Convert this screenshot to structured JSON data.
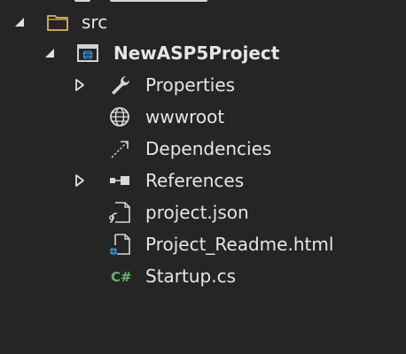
{
  "solution_explorer": {
    "items": [
      {
        "label": "src",
        "icon": "folder-icon",
        "expanded": true
      },
      {
        "label": "NewASP5Project",
        "icon": "web-project-icon",
        "expanded": true
      },
      {
        "label": "Properties",
        "icon": "wrench-icon",
        "expanded": false
      },
      {
        "label": "wwwroot",
        "icon": "globe-icon"
      },
      {
        "label": "Dependencies",
        "icon": "dependencies-arrow-icon"
      },
      {
        "label": "References",
        "icon": "references-icon",
        "expanded": false
      },
      {
        "label": "project.json",
        "icon": "json-file-icon"
      },
      {
        "label": "Project_Readme.html",
        "icon": "html-file-icon"
      },
      {
        "label": "Startup.cs",
        "icon": "csharp-file-icon"
      }
    ]
  },
  "colors": {
    "background": "#252526",
    "text": "#e6e6e6",
    "folder": "#c5a45a",
    "csharp": "#68b36b",
    "web_accent": "#3c9ee6"
  }
}
